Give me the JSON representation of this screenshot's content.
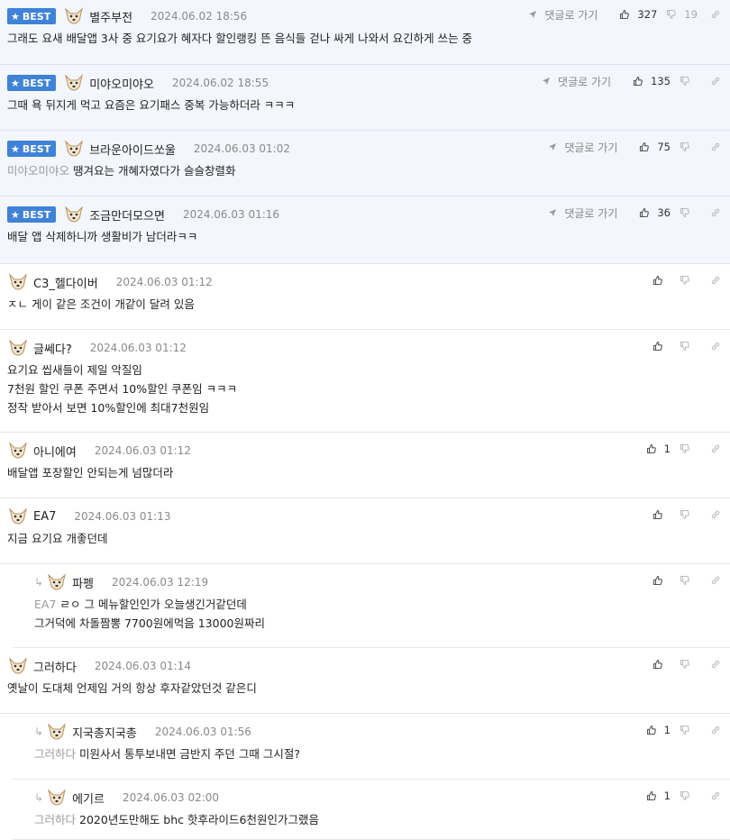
{
  "ui": {
    "best_badge": "BEST",
    "reply_label": "댓글로 가기"
  },
  "comments": [
    {
      "nick": "별주부전",
      "date": "2024.06.02 18:56",
      "best": true,
      "reply": false,
      "likes": "327",
      "dislikes": "19",
      "mention": "",
      "lines": [
        "그래도 요새 배달앱 3사 중 요기요가 혜자다 할인랭킹 뜬 음식들 걷나 싸게 나와서 요긴하게 쓰는 중"
      ]
    },
    {
      "nick": "미야오미야오",
      "date": "2024.06.02 18:55",
      "best": true,
      "reply": false,
      "likes": "135",
      "dislikes": "",
      "mention": "",
      "lines": [
        "그때 욕 뒤지게 먹고 요즘은 요기패스 중복 가능하더라 ㅋㅋㅋ"
      ]
    },
    {
      "nick": "브라운아이드쏘울",
      "date": "2024.06.03 01:02",
      "best": true,
      "reply": false,
      "likes": "75",
      "dislikes": "",
      "mention": "미야오미야오",
      "lines": [
        "땡겨요는 개혜자였다가 슬슬창렬화"
      ]
    },
    {
      "nick": "조금만더모으면",
      "date": "2024.06.03 01:16",
      "best": true,
      "reply": false,
      "likes": "36",
      "dislikes": "",
      "mention": "",
      "lines": [
        "배달 앱 삭제하니까 생활비가 남더라ㅋㅋ"
      ]
    },
    {
      "nick": "C3_헬다이버",
      "date": "2024.06.03 01:12",
      "best": false,
      "reply": false,
      "likes": "",
      "dislikes": "",
      "mention": "",
      "lines": [
        "ㅈㄴ 게이 같은 조건이 개같이 달려 있음"
      ]
    },
    {
      "nick": "글쎄다?",
      "date": "2024.06.03 01:12",
      "best": false,
      "reply": false,
      "likes": "",
      "dislikes": "",
      "mention": "",
      "lines": [
        "요기요 씹새들이 제일 악질임",
        "7천원 할인 쿠폰 주면서 10%할인 쿠폰임 ㅋㅋㅋ",
        "정작 받아서 보면 10%할인에 최대7천원임"
      ]
    },
    {
      "nick": "아니에여",
      "date": "2024.06.03 01:12",
      "best": false,
      "reply": false,
      "likes": "1",
      "dislikes": "",
      "mention": "",
      "lines": [
        "배달앱 포장할인 안되는게 넘많더라"
      ]
    },
    {
      "nick": "EA7",
      "date": "2024.06.03 01:13",
      "best": false,
      "reply": false,
      "likes": "",
      "dislikes": "",
      "mention": "",
      "lines": [
        "지금 요기요 개좋던데"
      ]
    },
    {
      "nick": "파펭",
      "date": "2024.06.03 12:19",
      "best": false,
      "reply": true,
      "likes": "",
      "dislikes": "",
      "mention": "EA7",
      "lines": [
        "ㄹㅇ 그 메뉴할인인가 오늘생긴거같던데",
        "그거덕에 차돌짬뽕 7700원에먹음 13000원짜리"
      ]
    },
    {
      "nick": "그러하다",
      "date": "2024.06.03 01:14",
      "best": false,
      "reply": false,
      "likes": "",
      "dislikes": "",
      "mention": "",
      "lines": [
        "옛날이 도대체 언제임 거의 항상 후자같았던것 같은디"
      ]
    },
    {
      "nick": "지국총지국총",
      "date": "2024.06.03 01:56",
      "best": false,
      "reply": true,
      "likes": "1",
      "dislikes": "",
      "mention": "그러하다",
      "lines": [
        "미원사서 통투보내면 금반지 주던 그때 그시절?"
      ]
    },
    {
      "nick": "에기르",
      "date": "2024.06.03 02:00",
      "best": false,
      "reply": true,
      "likes": "1",
      "dislikes": "",
      "mention": "그러하다",
      "lines": [
        "2020년도만해도 bhc 핫후라이드6천원인가그랬음"
      ]
    }
  ]
}
